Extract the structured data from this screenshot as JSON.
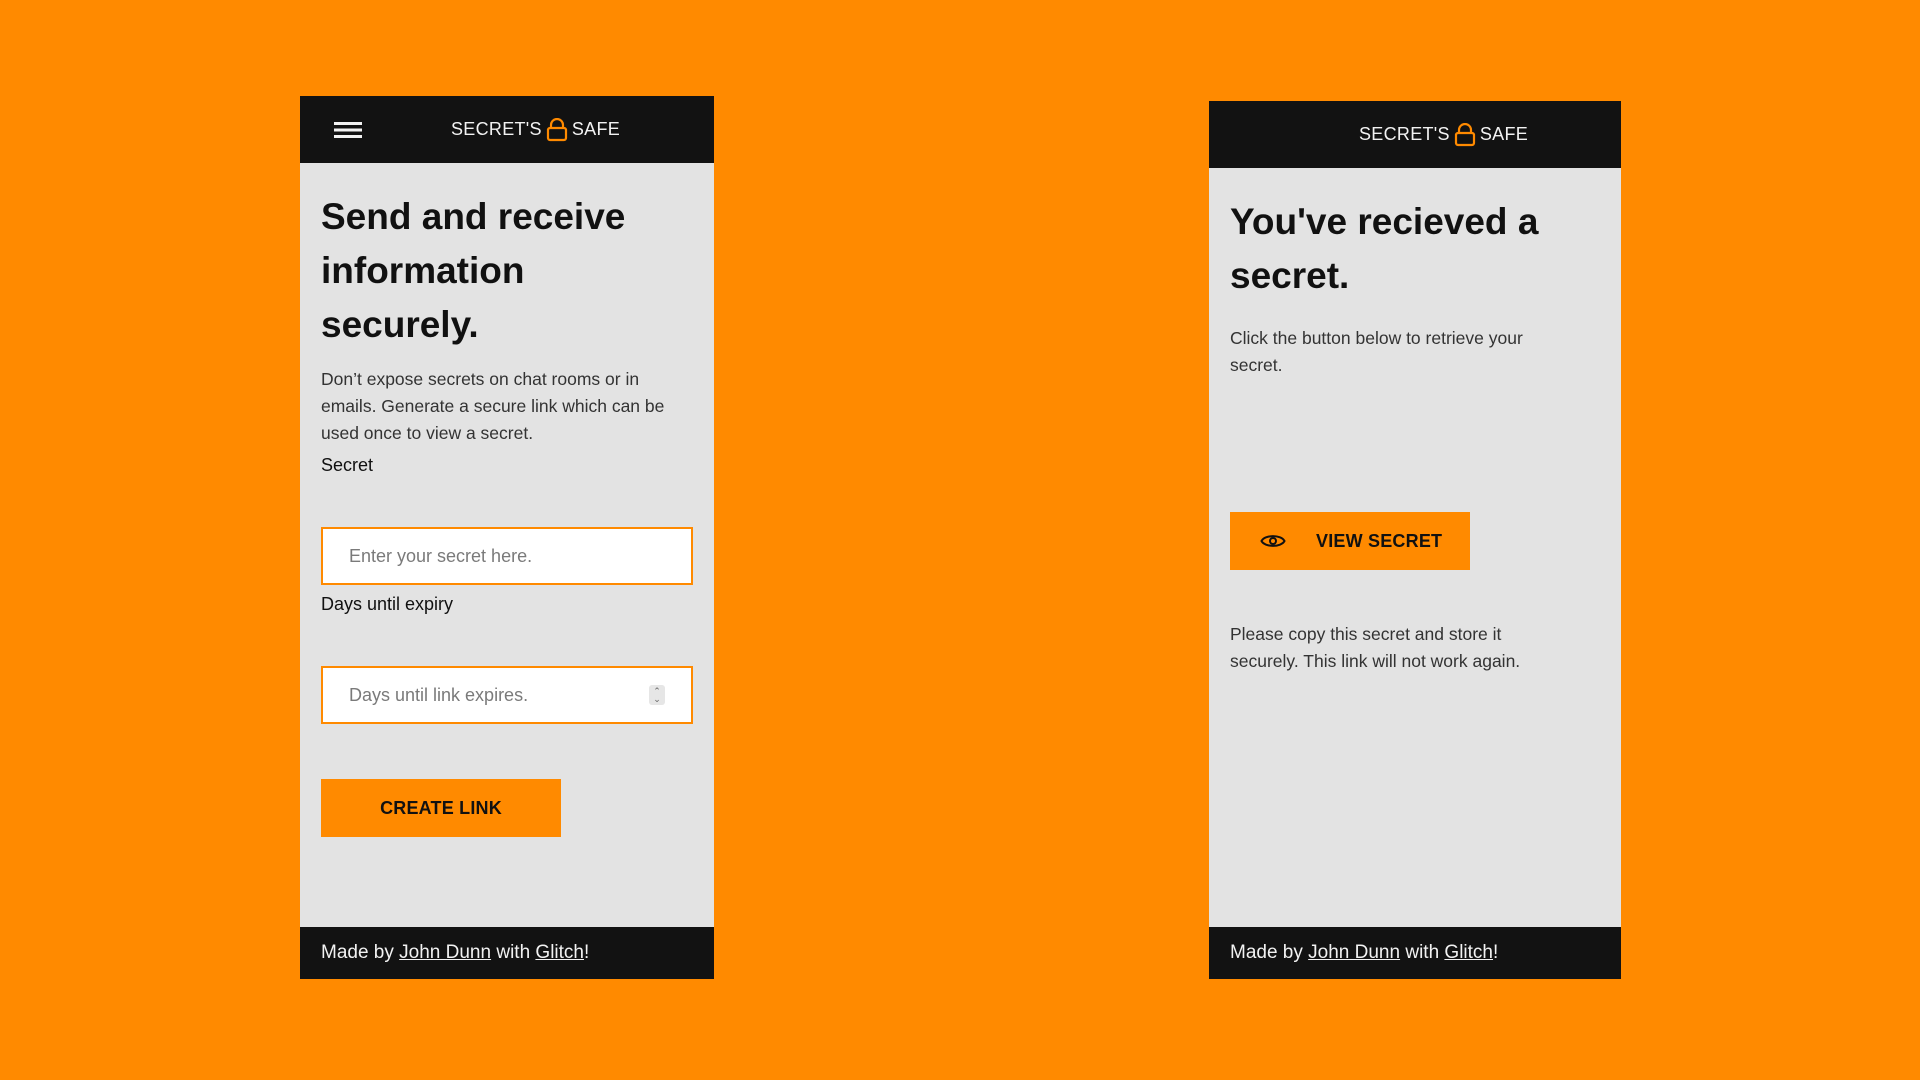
{
  "colors": {
    "background": "#ff8a00",
    "accent": "#ff8a00",
    "header": "#121212",
    "card": "#e3e3e3"
  },
  "brand": {
    "left_word": "SECRET'S",
    "right_word": "SAFE",
    "icon": "lock-icon"
  },
  "create_screen": {
    "heading": "Send and receive information securely.",
    "description": "Don’t expose secrets on chat rooms or in emails. Generate a secure link which can be used once to view a secret.",
    "secret_label": "Secret",
    "secret_placeholder": "Enter your secret here.",
    "expiry_label": "Days until expiry",
    "expiry_placeholder": "Days until link expires.",
    "button_label": "CREATE LINK",
    "menu_icon": "hamburger-menu-icon"
  },
  "view_screen": {
    "heading": "You've recieved a secret.",
    "description": "Click the button below to retrieve your secret.",
    "button_label": "VIEW SECRET",
    "button_icon": "eye-icon",
    "note": "Please copy this secret and store it securely. This link will not work again."
  },
  "footer": {
    "prefix": "Made by ",
    "author": "John Dunn",
    "middle": " with ",
    "platform": "Glitch",
    "suffix": "!"
  }
}
